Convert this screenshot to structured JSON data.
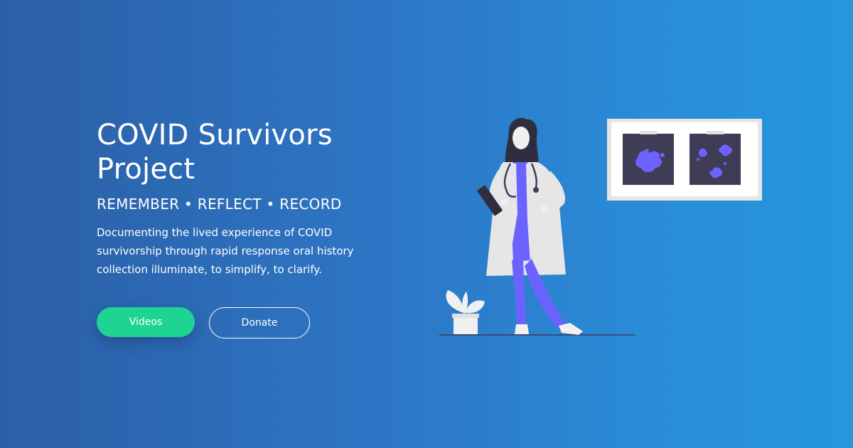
{
  "hero": {
    "title": "COVID Survivors Project",
    "tagline": "REMEMBER • REFLECT • RECORD",
    "description": "Documenting the lived experience of COVID survivorship through rapid response oral history collection illuminate, to simplify, to clarify."
  },
  "buttons": {
    "videos_label": "Videos",
    "donate_label": "Donate"
  },
  "colors": {
    "background_start": "#2c5fa6",
    "background_end": "#2598dd",
    "primary_button": "#1ed493",
    "accent_purple": "#6c63ff",
    "dark_panel": "#3f3d56"
  },
  "illustration": {
    "icons": [
      "doctor-figure",
      "xray-lightbox",
      "potted-plant",
      "stethoscope",
      "clipboard"
    ]
  }
}
